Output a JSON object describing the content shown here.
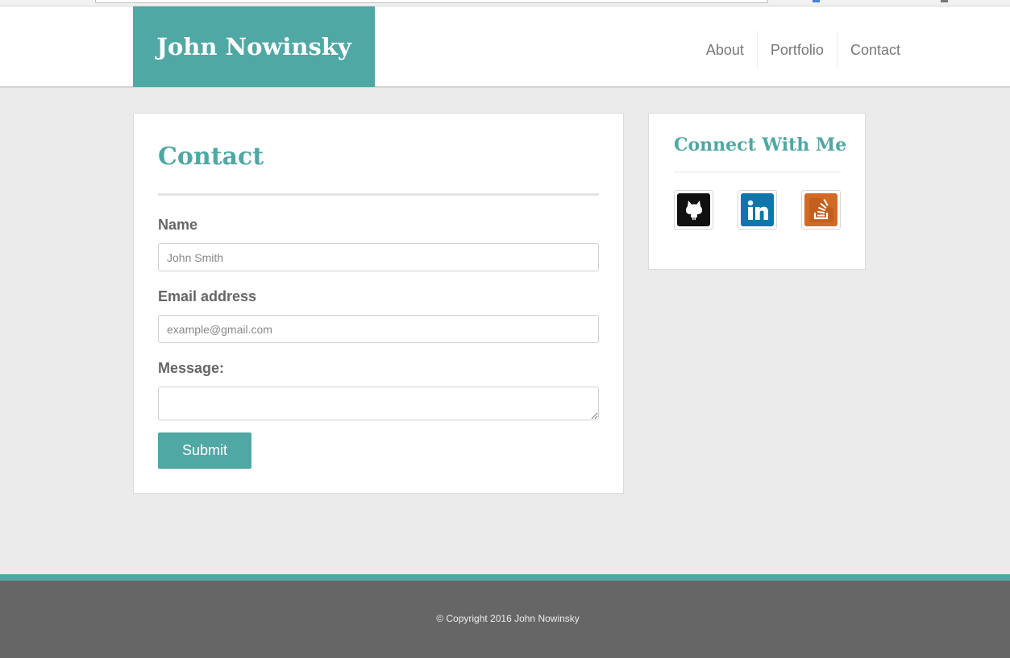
{
  "brand": {
    "name": "John Nowinsky"
  },
  "nav": {
    "items": [
      {
        "label": "About"
      },
      {
        "label": "Portfolio"
      },
      {
        "label": "Contact"
      }
    ]
  },
  "contact": {
    "title": "Contact",
    "name_label": "Name",
    "name_placeholder": "John Smith",
    "email_label": "Email address",
    "email_placeholder": "example@gmail.com",
    "message_label": "Message:",
    "message_value": "",
    "submit_label": "Submit"
  },
  "connect": {
    "title": "Connect With Me",
    "links": [
      {
        "icon": "github-icon",
        "color": "#111111"
      },
      {
        "icon": "linkedin-icon",
        "color": "#0e76a8"
      },
      {
        "icon": "stackoverflow-icon",
        "color": "#d26a26"
      }
    ]
  },
  "footer": {
    "copyright": "© Copyright 2016 John Nowinsky",
    "accent_color": "#4fa8a4"
  },
  "colors": {
    "accent": "#4fa8a4",
    "footer_bg": "#666666"
  }
}
